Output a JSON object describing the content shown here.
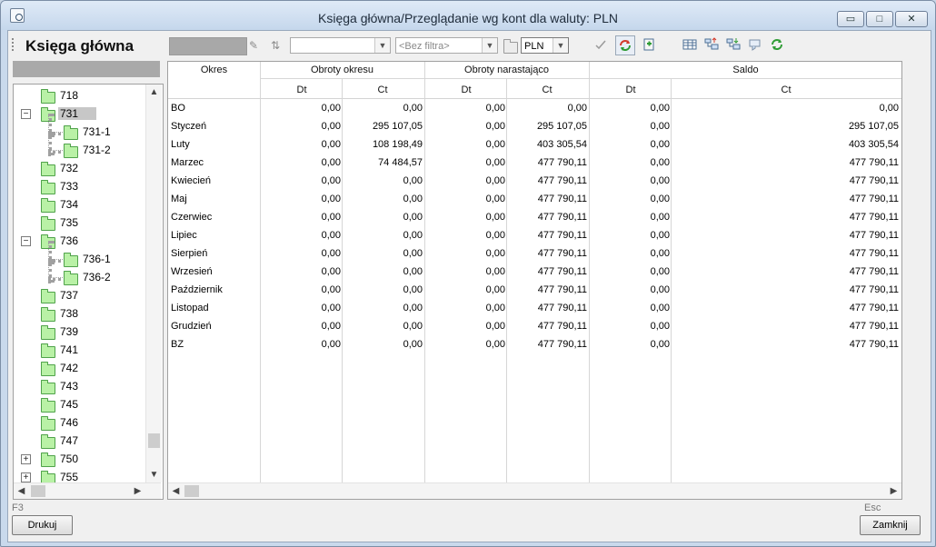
{
  "window": {
    "title": "Księga główna/Przeglądanie wg kont dla waluty: PLN",
    "minimize": "▭",
    "maximize": "□",
    "close": "✕"
  },
  "toolbar": {
    "title": "Księga główna",
    "filter_placeholder": "<Bez filtra>",
    "currency": "PLN"
  },
  "tree": {
    "items": [
      {
        "label": "718",
        "level": 0,
        "expander": ""
      },
      {
        "label": "731",
        "level": 0,
        "expander": "−",
        "selected": true
      },
      {
        "label": "731-1",
        "level": 1,
        "expander": ""
      },
      {
        "label": "731-2",
        "level": 1,
        "expander": ""
      },
      {
        "label": "732",
        "level": 0,
        "expander": ""
      },
      {
        "label": "733",
        "level": 0,
        "expander": ""
      },
      {
        "label": "734",
        "level": 0,
        "expander": ""
      },
      {
        "label": "735",
        "level": 0,
        "expander": ""
      },
      {
        "label": "736",
        "level": 0,
        "expander": "−"
      },
      {
        "label": "736-1",
        "level": 1,
        "expander": ""
      },
      {
        "label": "736-2",
        "level": 1,
        "expander": ""
      },
      {
        "label": "737",
        "level": 0,
        "expander": ""
      },
      {
        "label": "738",
        "level": 0,
        "expander": ""
      },
      {
        "label": "739",
        "level": 0,
        "expander": ""
      },
      {
        "label": "741",
        "level": 0,
        "expander": ""
      },
      {
        "label": "742",
        "level": 0,
        "expander": ""
      },
      {
        "label": "743",
        "level": 0,
        "expander": ""
      },
      {
        "label": "745",
        "level": 0,
        "expander": ""
      },
      {
        "label": "746",
        "level": 0,
        "expander": ""
      },
      {
        "label": "747",
        "level": 0,
        "expander": ""
      },
      {
        "label": "750",
        "level": 0,
        "expander": "+"
      },
      {
        "label": "755",
        "level": 0,
        "expander": "+"
      }
    ]
  },
  "grid": {
    "headers": {
      "okres": "Okres",
      "obroty_okresu": "Obroty okresu",
      "obroty_narastajaco": "Obroty narastająco",
      "saldo": "Saldo",
      "dt": "Dt",
      "ct": "Ct"
    },
    "rows": [
      {
        "okres": "BO",
        "c1": "0,00",
        "c2": "0,00",
        "c3": "0,00",
        "c4": "0,00",
        "c5": "0,00",
        "c6": "0,00"
      },
      {
        "okres": "Styczeń",
        "c1": "0,00",
        "c2": "295 107,05",
        "c3": "0,00",
        "c4": "295 107,05",
        "c5": "0,00",
        "c6": "295 107,05"
      },
      {
        "okres": "Luty",
        "c1": "0,00",
        "c2": "108 198,49",
        "c3": "0,00",
        "c4": "403 305,54",
        "c5": "0,00",
        "c6": "403 305,54"
      },
      {
        "okres": "Marzec",
        "c1": "0,00",
        "c2": "74 484,57",
        "c3": "0,00",
        "c4": "477 790,11",
        "c5": "0,00",
        "c6": "477 790,11"
      },
      {
        "okres": "Kwiecień",
        "c1": "0,00",
        "c2": "0,00",
        "c3": "0,00",
        "c4": "477 790,11",
        "c5": "0,00",
        "c6": "477 790,11"
      },
      {
        "okres": "Maj",
        "c1": "0,00",
        "c2": "0,00",
        "c3": "0,00",
        "c4": "477 790,11",
        "c5": "0,00",
        "c6": "477 790,11"
      },
      {
        "okres": "Czerwiec",
        "c1": "0,00",
        "c2": "0,00",
        "c3": "0,00",
        "c4": "477 790,11",
        "c5": "0,00",
        "c6": "477 790,11"
      },
      {
        "okres": "Lipiec",
        "c1": "0,00",
        "c2": "0,00",
        "c3": "0,00",
        "c4": "477 790,11",
        "c5": "0,00",
        "c6": "477 790,11"
      },
      {
        "okres": "Sierpień",
        "c1": "0,00",
        "c2": "0,00",
        "c3": "0,00",
        "c4": "477 790,11",
        "c5": "0,00",
        "c6": "477 790,11"
      },
      {
        "okres": "Wrzesień",
        "c1": "0,00",
        "c2": "0,00",
        "c3": "0,00",
        "c4": "477 790,11",
        "c5": "0,00",
        "c6": "477 790,11"
      },
      {
        "okres": "Październik",
        "c1": "0,00",
        "c2": "0,00",
        "c3": "0,00",
        "c4": "477 790,11",
        "c5": "0,00",
        "c6": "477 790,11"
      },
      {
        "okres": "Listopad",
        "c1": "0,00",
        "c2": "0,00",
        "c3": "0,00",
        "c4": "477 790,11",
        "c5": "0,00",
        "c6": "477 790,11"
      },
      {
        "okres": "Grudzień",
        "c1": "0,00",
        "c2": "0,00",
        "c3": "0,00",
        "c4": "477 790,11",
        "c5": "0,00",
        "c6": "477 790,11"
      },
      {
        "okres": "BZ",
        "c1": "0,00",
        "c2": "0,00",
        "c3": "0,00",
        "c4": "477 790,11",
        "c5": "0,00",
        "c6": "477 790,11"
      }
    ]
  },
  "footer": {
    "hotkey_print": "F3",
    "print_label": "Drukuj",
    "hotkey_close": "Esc",
    "close_label": "Zamknij"
  }
}
